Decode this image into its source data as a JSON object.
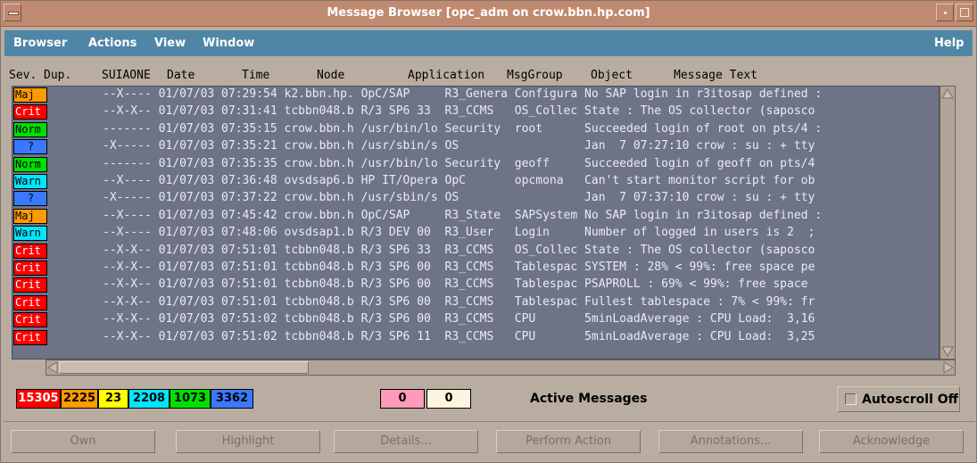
{
  "window": {
    "title": "Message Browser  [opc_adm on crow.bbn.hp.com]"
  },
  "menubar": {
    "browser": "Browser",
    "actions": "Actions",
    "view": "View",
    "window": "Window",
    "help": "Help"
  },
  "columns": {
    "sev": "Sev.",
    "dup": "Dup.",
    "suiaone": "SUIAONE",
    "date": "Date",
    "time": "Time",
    "node": "Node",
    "application": "Application",
    "msggroup": "MsgGroup",
    "object": "Object",
    "message_text": "Message Text"
  },
  "severity_colors": {
    "Maj": "#ff9a00",
    "Crit": "#ff0000",
    "Norm": "#00e000",
    "?": "#3a78ff",
    "Warn": "#00e6ff"
  },
  "messages": [
    {
      "sev": "Maj",
      "text": "--X---- 01/07/03 07:29:54 k2.bbn.hp. OpC/SAP     R3_Genera Configura No SAP login in r3itosap defined :"
    },
    {
      "sev": "Crit",
      "text": "--X-X-- 01/07/03 07:31:41 tcbbn048.b R/3 SP6 33  R3_CCMS   OS_Collec State : The OS collector (saposco"
    },
    {
      "sev": "Norm",
      "text": "------- 01/07/03 07:35:15 crow.bbn.h /usr/bin/lo Security  root      Succeeded login of root on pts/4 :"
    },
    {
      "sev": "?",
      "text": "-X----- 01/07/03 07:35:21 crow.bbn.h /usr/sbin/s OS                  Jan  7 07:27:10 crow : su : + tty"
    },
    {
      "sev": "Norm",
      "text": "------- 01/07/03 07:35:35 crow.bbn.h /usr/bin/lo Security  geoff     Succeeded login of geoff on pts/4"
    },
    {
      "sev": "Warn",
      "text": "--X---- 01/07/03 07:36:48 ovsdsap6.b HP IT/Opera OpC       opcmona   Can't start monitor script for ob"
    },
    {
      "sev": "?",
      "text": "-X----- 01/07/03 07:37:22 crow.bbn.h /usr/sbin/s OS                  Jan  7 07:37:10 crow : su : + tty"
    },
    {
      "sev": "Maj",
      "text": "--X---- 01/07/03 07:45:42 crow.bbn.h OpC/SAP     R3_State  SAPSystem No SAP login in r3itosap defined :"
    },
    {
      "sev": "Warn",
      "text": "--X---- 01/07/03 07:48:06 ovsdsap1.b R/3 DEV 00  R3_User   Login     Number of logged in users is 2  ;"
    },
    {
      "sev": "Crit",
      "text": "--X-X-- 01/07/03 07:51:01 tcbbn048.b R/3 SP6 33  R3_CCMS   OS_Collec State : The OS collector (saposco"
    },
    {
      "sev": "Crit",
      "text": "--X-X-- 01/07/03 07:51:01 tcbbn048.b R/3 SP6 00  R3_CCMS   Tablespac SYSTEM : 28% < 99%: free space pe"
    },
    {
      "sev": "Crit",
      "text": "--X-X-- 01/07/03 07:51:01 tcbbn048.b R/3 SP6 00  R3_CCMS   Tablespac PSAPROLL : 69% < 99%: free space"
    },
    {
      "sev": "Crit",
      "text": "--X-X-- 01/07/03 07:51:01 tcbbn048.b R/3 SP6 00  R3_CCMS   Tablespac Fullest tablespace : 7% < 99%: fr"
    },
    {
      "sev": "Crit",
      "text": "--X-X-- 01/07/03 07:51:02 tcbbn048.b R/3 SP6 00  R3_CCMS   CPU       5minLoadAverage : CPU Load:  3,16"
    },
    {
      "sev": "Crit",
      "text": "--X-X-- 01/07/03 07:51:02 tcbbn048.b R/3 SP6 11  R3_CCMS   CPU       5minLoadAverage : CPU Load:  3,25"
    }
  ],
  "counters": [
    {
      "value": "15305",
      "color": "#ff0000",
      "text_color": "#ffffff"
    },
    {
      "value": "2225",
      "color": "#ff9a00",
      "text_color": "#000000"
    },
    {
      "value": "23",
      "color": "#ffff00",
      "text_color": "#000000"
    },
    {
      "value": "2208",
      "color": "#00e6ff",
      "text_color": "#000000"
    },
    {
      "value": "1073",
      "color": "#00e000",
      "text_color": "#000000"
    },
    {
      "value": "3362",
      "color": "#3a78ff",
      "text_color": "#000000"
    }
  ],
  "extra_counters": [
    {
      "value": "0",
      "color": "#ff9ab8"
    },
    {
      "value": "0",
      "color": "#fff4e0"
    }
  ],
  "status": {
    "active_label": "Active Messages",
    "autoscroll_label": "Autoscroll Off"
  },
  "buttons": {
    "own": "Own",
    "highlight": "Highlight",
    "details": "Details...",
    "perform_action": "Perform Action",
    "annotations": "Annotations...",
    "acknowledge": "Acknowledge"
  }
}
